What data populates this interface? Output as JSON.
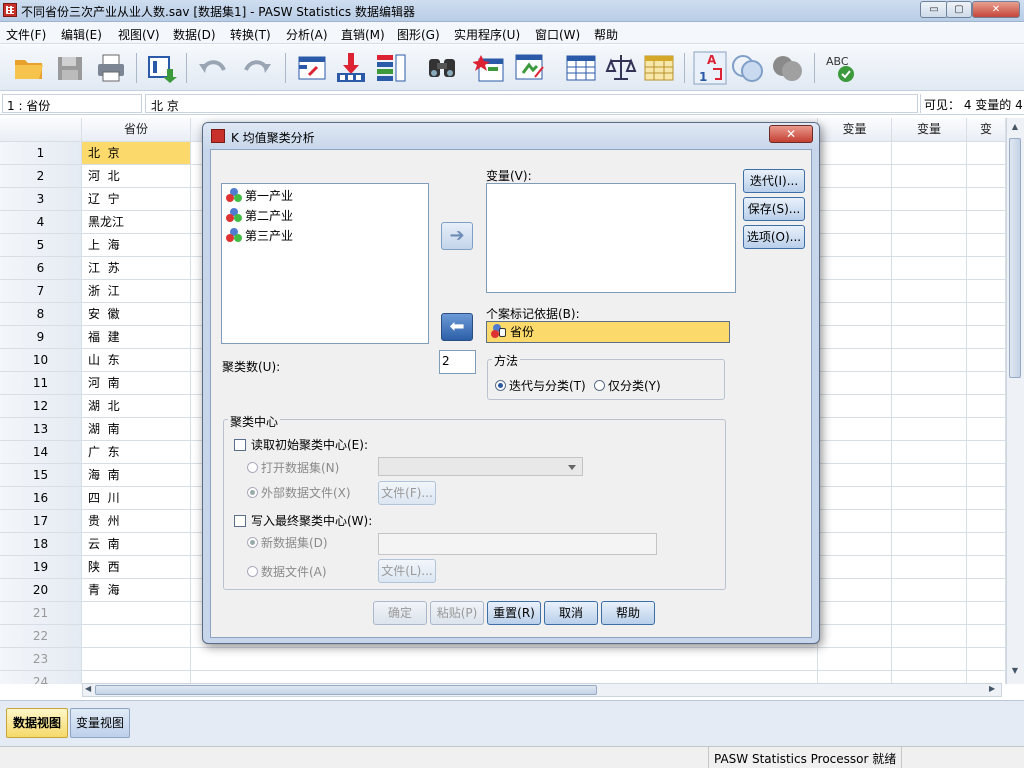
{
  "window": {
    "title": "不同省份三次产业从业人数.sav [数据集1] - PASW Statistics 数据编辑器",
    "controls": [
      "▭",
      "▢",
      "✕"
    ]
  },
  "menu": [
    "文件(F)",
    "编辑(E)",
    "视图(V)",
    "数据(D)",
    "转换(T)",
    "分析(A)",
    "直销(M)",
    "图形(G)",
    "实用程序(U)",
    "窗口(W)",
    "帮助"
  ],
  "toolbar": {
    "icons": [
      "open-folder-icon",
      "save-icon",
      "print-icon",
      "dialog-recall-icon",
      "undo-icon",
      "redo-icon",
      "goto-case-icon",
      "goto-variable-icon",
      "variables-icon",
      "find-icon",
      "insert-cases-icon",
      "insert-variable-icon",
      "split-file-icon",
      "weight-cases-icon",
      "select-cases-icon",
      "value-labels-icon",
      "use-sets-icon",
      "show-all-variables-icon",
      "spell-check-icon"
    ]
  },
  "cell_info": {
    "ref": "1 : 省份",
    "value": "北 京",
    "visible": "可见： 4 变量的 4"
  },
  "grid": {
    "column_header": "省份",
    "extra_columns": [
      "变量",
      "变量",
      "变"
    ],
    "rows": [
      {
        "n": "1",
        "v": "北  京"
      },
      {
        "n": "2",
        "v": "河  北"
      },
      {
        "n": "3",
        "v": "辽  宁"
      },
      {
        "n": "4",
        "v": "黑龙江"
      },
      {
        "n": "5",
        "v": "上  海"
      },
      {
        "n": "6",
        "v": "江  苏"
      },
      {
        "n": "7",
        "v": "浙  江"
      },
      {
        "n": "8",
        "v": "安  徽"
      },
      {
        "n": "9",
        "v": "福  建"
      },
      {
        "n": "10",
        "v": "山  东"
      },
      {
        "n": "11",
        "v": "河  南"
      },
      {
        "n": "12",
        "v": "湖  北"
      },
      {
        "n": "13",
        "v": "湖  南"
      },
      {
        "n": "14",
        "v": "广  东"
      },
      {
        "n": "15",
        "v": "海  南"
      },
      {
        "n": "16",
        "v": "四  川"
      },
      {
        "n": "17",
        "v": "贵  州"
      },
      {
        "n": "18",
        "v": "云  南"
      },
      {
        "n": "19",
        "v": "陕  西"
      },
      {
        "n": "20",
        "v": "青  海"
      },
      {
        "n": "21",
        "v": ""
      },
      {
        "n": "22",
        "v": ""
      },
      {
        "n": "23",
        "v": ""
      },
      {
        "n": "24",
        "v": ""
      }
    ]
  },
  "view_tabs": {
    "data_view": "数据视图",
    "variable_view": "变量视图"
  },
  "status": "PASW Statistics Processor 就绪",
  "dialog": {
    "title": "K 均值聚类分析",
    "close": "✕",
    "source_variables": [
      "第一产业",
      "第二产业",
      "第三产业"
    ],
    "variables_label": "变量(V):",
    "case_label_label": "个案标记依据(B):",
    "case_label_value": "省份",
    "num_clusters_label": "聚类数(U):",
    "num_clusters_value": "2",
    "method": {
      "label": "方法",
      "iterate_classify": "迭代与分类(T)",
      "classify_only": "仅分类(Y)"
    },
    "side_buttons": {
      "iterate": "迭代(I)...",
      "save": "保存(S)...",
      "options": "选项(O)..."
    },
    "cluster_centers": {
      "label": "聚类中心",
      "read_initial": "读取初始聚类中心(E):",
      "open_dataset": "打开数据集(N)",
      "external_file": "外部数据文件(X)",
      "file_btn_1": "文件(F)...",
      "write_final": "写入最终聚类中心(W):",
      "new_dataset": "新数据集(D)",
      "data_file": "数据文件(A)",
      "file_btn_2": "文件(L)..."
    },
    "buttons": {
      "ok": "确定",
      "paste": "粘贴(P)",
      "reset": "重置(R)",
      "cancel": "取消",
      "help": "帮助"
    }
  }
}
